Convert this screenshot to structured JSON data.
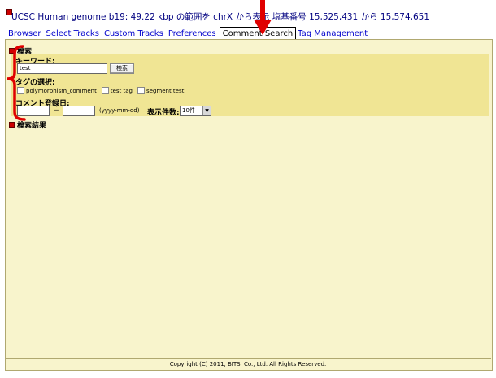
{
  "title": "UCSC Human genome b19: 49.22 kbp の範囲を chrX から表示 塩基番号 15,525,431 から 15,574,651",
  "tabs": [
    {
      "label": "Browser"
    },
    {
      "label": "Select Tracks"
    },
    {
      "label": "Custom Tracks"
    },
    {
      "label": "Preferences"
    },
    {
      "label": "Comment Search"
    },
    {
      "label": "Tag Management"
    }
  ],
  "search": {
    "heading": "検索",
    "keyword_label": "キーワード:",
    "keyword_value": "test",
    "search_button": "検索",
    "tag_label": "タグの選択:",
    "tags": [
      "polymorphism_comment",
      "test tag",
      "segment test"
    ],
    "date_label": "コメント登録日:",
    "date_separator": "－",
    "date_format": "(yyyy-mm-dd)",
    "count_label": "表示件数:",
    "count_value": "10件"
  },
  "results": {
    "heading": "検索結果"
  },
  "footer": "Copyright (C) 2011, BITS. Co., Ltd. All Rights Reserved.",
  "colors": {
    "annotation_red": "#e00000",
    "panel_bg": "#f8f4cc",
    "search_bg": "#f0e594"
  }
}
